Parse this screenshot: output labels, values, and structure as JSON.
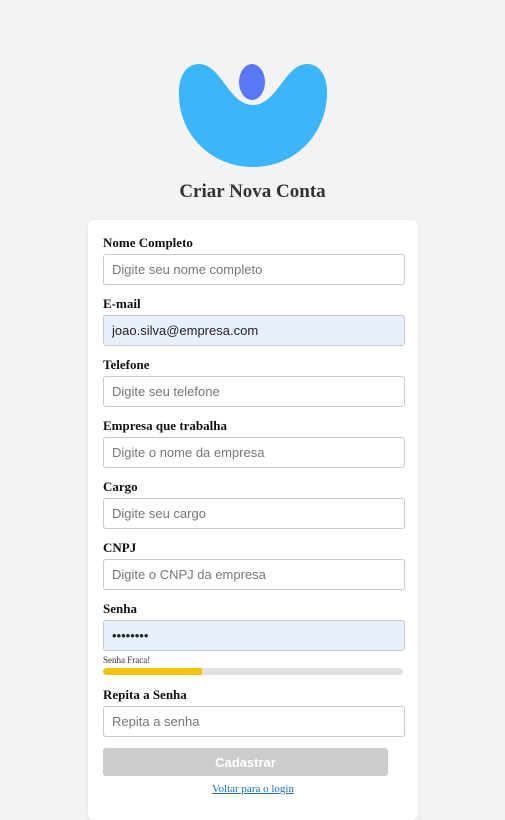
{
  "header": {
    "title": "Criar Nova Conta"
  },
  "colors": {
    "logo_primary": "#3bb6fb",
    "logo_accent": "#5879f6",
    "input_autofill_bg": "#e8f0fe",
    "strength_fill": "#f4c20d",
    "button_disabled": "#cccccc",
    "link": "#1a73b8"
  },
  "form": {
    "fields": [
      {
        "label": "Nome Completo",
        "value": "",
        "placeholder": "Digite seu nome completo"
      },
      {
        "label": "E-mail",
        "value": "joao.silva@empresa.com",
        "placeholder": ""
      },
      {
        "label": "Telefone",
        "value": "",
        "placeholder": "Digite seu telefone"
      },
      {
        "label": "Empresa que trabalha",
        "value": "",
        "placeholder": "Digite o nome da empresa"
      },
      {
        "label": "Cargo",
        "value": "",
        "placeholder": "Digite seu cargo"
      },
      {
        "label": "CNPJ",
        "value": "",
        "placeholder": "Digite o CNPJ da empresa"
      },
      {
        "label": "Senha",
        "value": "senha123",
        "placeholder": ""
      },
      {
        "label": "Repita a Senha",
        "value": "",
        "placeholder": "Repita a senha"
      }
    ],
    "password_strength": {
      "text": "Senha Fraca!",
      "level_fraction": 0.33
    },
    "submit_label": "Cadastrar",
    "back_link_label": "Voltar para o login"
  }
}
